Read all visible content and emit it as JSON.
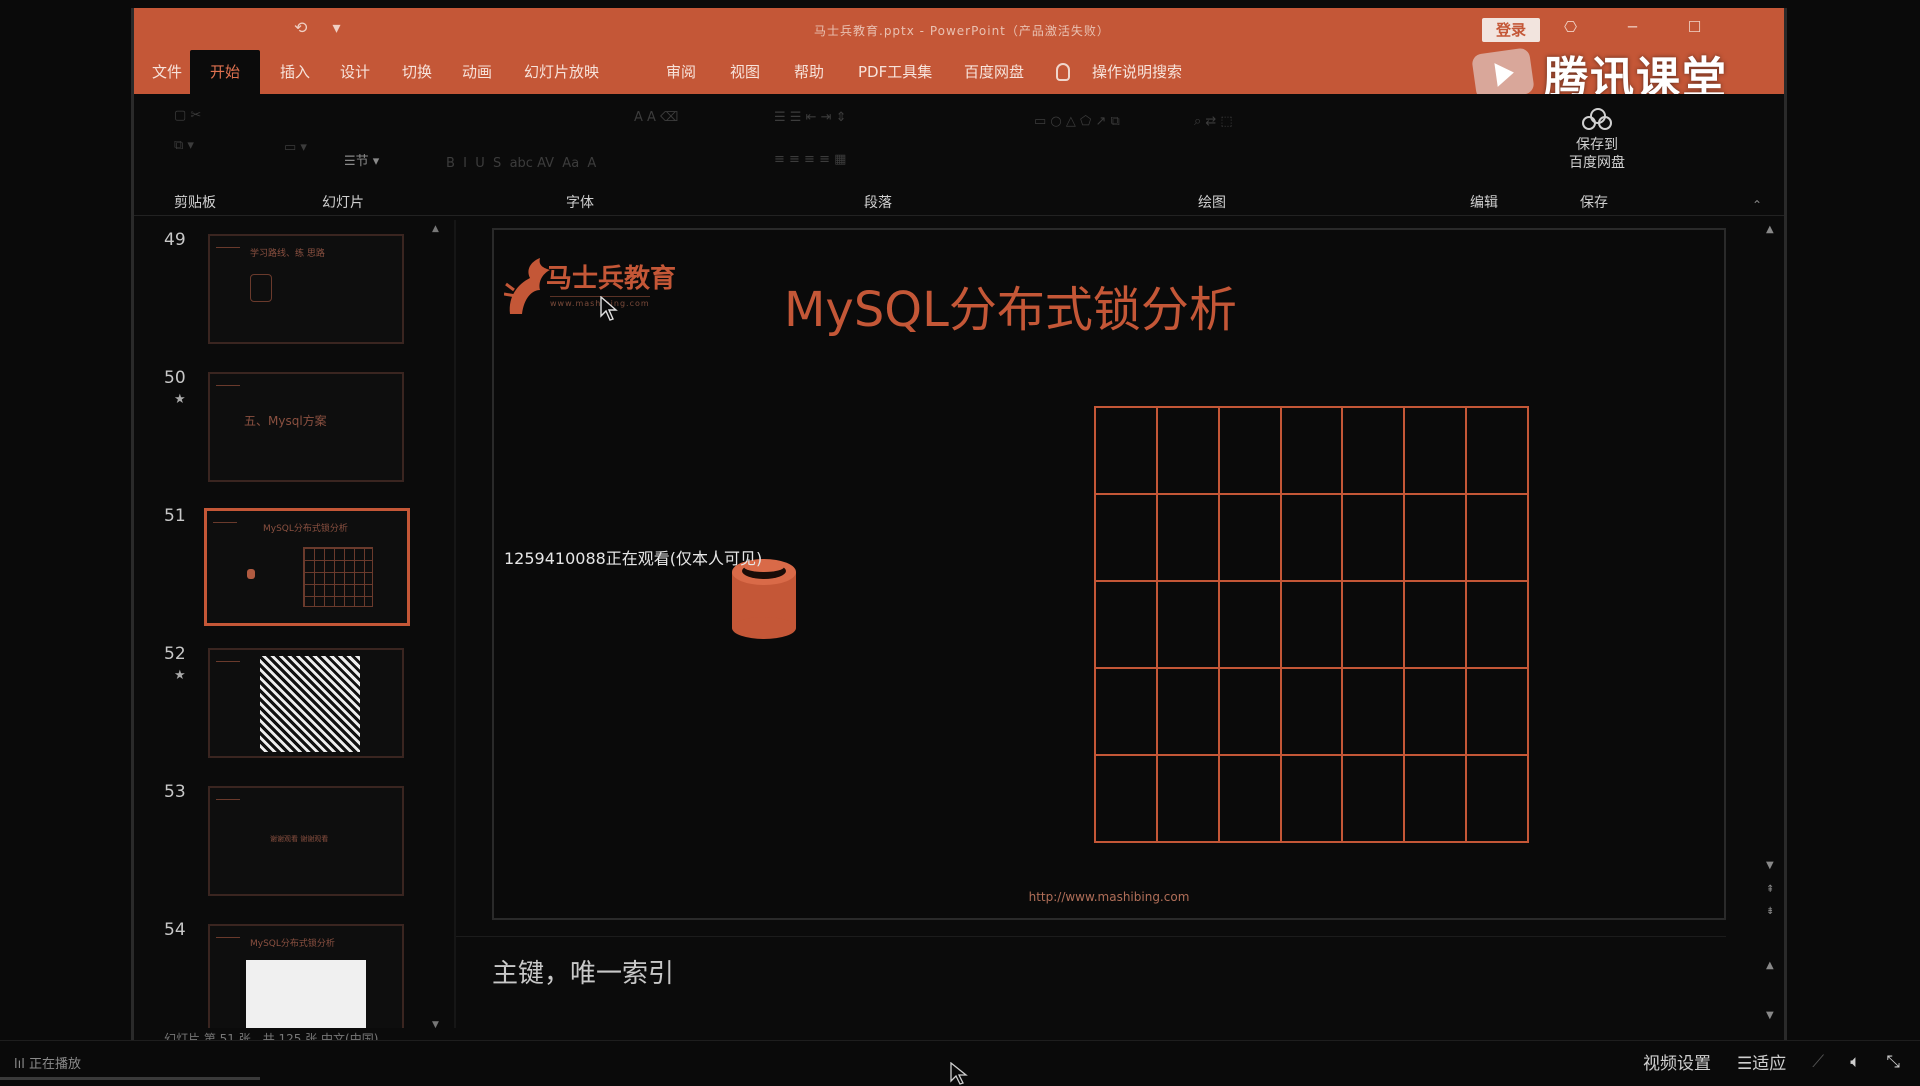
{
  "app": {
    "quick_access": [
      "⟲",
      "▾"
    ],
    "doc_title": "马士兵教育.pptx - PowerPoint（产品激活失败）",
    "login_label": "登录",
    "window_controls": [
      "⎔",
      "─",
      "☐"
    ]
  },
  "watermark": {
    "text": "腾讯课堂"
  },
  "tabs": [
    {
      "label": "文件"
    },
    {
      "label": "开始"
    },
    {
      "label": "插入"
    },
    {
      "label": "设计"
    },
    {
      "label": "切换"
    },
    {
      "label": "动画"
    },
    {
      "label": "幻灯片放映"
    },
    {
      "label": "审阅"
    },
    {
      "label": "视图"
    },
    {
      "label": "帮助"
    },
    {
      "label": "PDF工具集"
    },
    {
      "label": "百度网盘"
    },
    {
      "label": "操作说明搜索"
    }
  ],
  "ribbon": {
    "groups": [
      "剪贴板",
      "幻灯片",
      "字体",
      "段落",
      "绘图",
      "编辑",
      "保存"
    ],
    "save_button": {
      "line1": "保存到",
      "line2": "百度网盘"
    },
    "section_label": "节"
  },
  "thumbnails": [
    {
      "number": "49",
      "star": "",
      "caption": "学习路线、练  思路"
    },
    {
      "number": "50",
      "star": "★",
      "caption": "五、Mysql方案"
    },
    {
      "number": "51",
      "star": "",
      "caption": "MySQL分布式锁分析"
    },
    {
      "number": "52",
      "star": "★",
      "caption": ""
    },
    {
      "number": "53",
      "star": "",
      "caption": "谢谢观看 谢谢观看"
    },
    {
      "number": "54",
      "star": "",
      "caption": "MySQL分布式锁分析"
    }
  ],
  "slide": {
    "logo_text": "马士兵教育",
    "logo_sub": "www.mashibing.com",
    "title": "MySQL分布式锁分析",
    "url": "http://www.mashibing.com",
    "grid_rows": 5,
    "grid_cols": 7
  },
  "viewer_tip": "1259410088正在观看(仅本人可见)",
  "notes": "主键，唯一索引",
  "status": "幻灯片 第 51 张，共 125 张    中文(中国)",
  "player": {
    "left_label": "正在播放",
    "video_settings": "视频设置",
    "fit_label": "适应"
  },
  "colors": {
    "accent": "#c45737",
    "background": "#0b0b0b"
  }
}
